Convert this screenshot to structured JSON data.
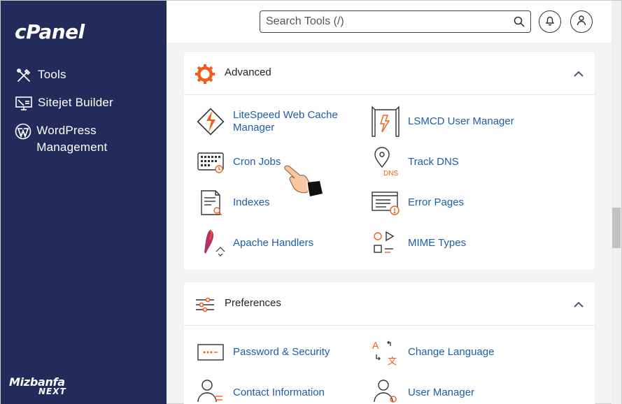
{
  "brand": {
    "logo": "cPanel",
    "watermark_main": "Mizbanfa",
    "watermark_sub": "NEXT"
  },
  "sidebar": {
    "items": [
      {
        "label": "Tools",
        "icon": "tools-icon"
      },
      {
        "label": "Sitejet Builder",
        "icon": "monitor-icon"
      },
      {
        "label": "WordPress Management",
        "icon": "wordpress-icon"
      }
    ]
  },
  "header": {
    "search_placeholder": "Search Tools (/)"
  },
  "sections": {
    "advanced": {
      "title": "Advanced",
      "items": [
        {
          "label": "LiteSpeed Web Cache Manager",
          "icon": "litespeed-icon"
        },
        {
          "label": "LSMCD User Manager",
          "icon": "lsmcd-icon"
        },
        {
          "label": "Cron Jobs",
          "icon": "cron-jobs-icon"
        },
        {
          "label": "Track DNS",
          "icon": "track-dns-icon"
        },
        {
          "label": "Indexes",
          "icon": "indexes-icon"
        },
        {
          "label": "Error Pages",
          "icon": "error-pages-icon"
        },
        {
          "label": "Apache Handlers",
          "icon": "apache-handlers-icon"
        },
        {
          "label": "MIME Types",
          "icon": "mime-types-icon"
        }
      ]
    },
    "preferences": {
      "title": "Preferences",
      "items": [
        {
          "label": "Password & Security",
          "icon": "password-icon"
        },
        {
          "label": "Change Language",
          "icon": "language-icon"
        },
        {
          "label": "Contact Information",
          "icon": "contact-icon"
        },
        {
          "label": "User Manager",
          "icon": "user-manager-icon"
        }
      ]
    }
  },
  "colors": {
    "sidebar": "#232b5a",
    "link": "#1d5ea8",
    "accent": "#f25c19"
  }
}
